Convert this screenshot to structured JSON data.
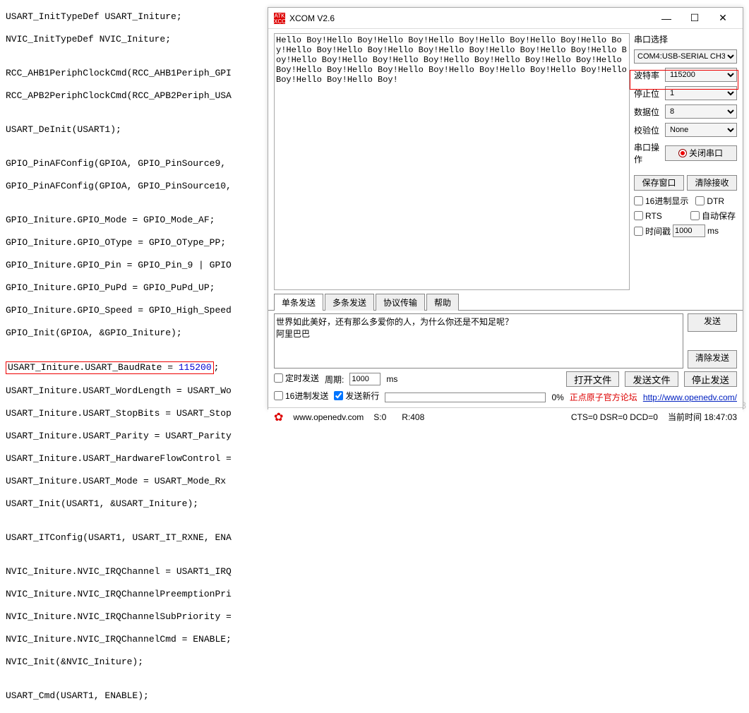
{
  "code": {
    "lines": [
      "USART_InitTypeDef USART_Initure;",
      "NVIC_InitTypeDef NVIC_Initure;",
      "",
      "RCC_AHB1PeriphClockCmd(RCC_AHB1Periph_GPI",
      "RCC_APB2PeriphClockCmd(RCC_APB2Periph_USA",
      "",
      "USART_DeInit(USART1);",
      "",
      "GPIO_PinAFConfig(GPIOA, GPIO_PinSource9, ",
      "GPIO_PinAFConfig(GPIOA, GPIO_PinSource10,",
      "",
      "GPIO_Initure.GPIO_Mode = GPIO_Mode_AF;",
      "GPIO_Initure.GPIO_OType = GPIO_OType_PP;",
      "GPIO_Initure.GPIO_Pin = GPIO_Pin_9 | GPIO",
      "GPIO_Initure.GPIO_PuPd = GPIO_PuPd_UP;",
      "GPIO_Initure.GPIO_Speed = GPIO_High_Speed",
      "GPIO_Init(GPIOA, &GPIO_Initure);",
      "",
      "USART_Initure.USART_BaudRate = ",
      "USART_Initure.USART_WordLength = USART_Wo",
      "USART_Initure.USART_StopBits = USART_Stop",
      "USART_Initure.USART_Parity = USART_Parity",
      "USART_Initure.USART_HardwareFlowControl =",
      "USART_Initure.USART_Mode = USART_Mode_Rx ",
      "USART_Init(USART1, &USART_Initure);",
      "",
      "USART_ITConfig(USART1, USART_IT_RXNE, ENA",
      "",
      "NVIC_Initure.NVIC_IRQChannel = USART1_IRQ",
      "NVIC_Initure.NVIC_IRQChannelPreemptionPri",
      "NVIC_Initure.NVIC_IRQChannelSubPriority =",
      "NVIC_Initure.NVIC_IRQChannelCmd = ENABLE;",
      "NVIC_Init(&NVIC_Initure);",
      "",
      "USART_Cmd(USART1, ENABLE);"
    ],
    "baud_num": "115200",
    "baud_suffix": ";"
  },
  "xcom": {
    "title": "XCOM V2.6",
    "icon_text": "ATK\nXCOM",
    "recv_text": "Hello Boy!Hello Boy!Hello Boy!Hello Boy!Hello Boy!Hello Boy!Hello Boy!Hello Boy!Hello Boy!Hello Boy!Hello Boy!Hello Boy!Hello Boy!Hello Boy!Hello Boy!Hello Boy!Hello Boy!Hello Boy!Hello Boy!Hello Boy!Hello Boy!Hello Boy!Hello Boy!Hello Boy!Hello Boy!Hello Boy!Hello Boy!Hello Boy!Hello Boy!Hello Boy!",
    "side": {
      "port_label": "串口选择",
      "port_value": "COM4:USB-SERIAL CH340",
      "baud_label": "波特率",
      "baud_value": "115200",
      "stop_label": "停止位",
      "stop_value": "1",
      "data_label": "数据位",
      "data_value": "8",
      "parity_label": "校验位",
      "parity_value": "None",
      "op_label": "串口操作",
      "op_btn": "关闭串口",
      "save_btn": "保存窗口",
      "clear_btn": "清除接收",
      "hex_disp": "16进制显示",
      "dtr": "DTR",
      "rts": "RTS",
      "autosave": "自动保存",
      "timestamp": "时间戳",
      "ts_num": "1000",
      "ts_unit": "ms"
    },
    "tabs": {
      "t1": "单条发送",
      "t2": "多条发送",
      "t3": "协议传输",
      "t4": "帮助"
    },
    "send_text": "世界如此美好，还有那么多爱你的人，为什么你还是不知足呢？\n阿里巴巴",
    "send_btn": "发送",
    "clear_send_btn": "清除发送",
    "opts": {
      "timed": "定时发送",
      "period_lbl": "周期:",
      "period_val": "1000",
      "period_unit": "ms",
      "open_file": "打开文件",
      "send_file": "发送文件",
      "stop_send": "停止发送",
      "hex_send": "16进制发送",
      "newline": "发送新行",
      "pct": "0%",
      "forum_text": "正点原子官方论坛",
      "forum_url": "http://www.openedv.com/"
    },
    "status": {
      "url": "www.openedv.com",
      "s": "S:0",
      "r": "R:408",
      "cts": "CTS=0 DSR=0 DCD=0",
      "time": "当前时间 18:47:03"
    }
  },
  "watermark": "36553708"
}
